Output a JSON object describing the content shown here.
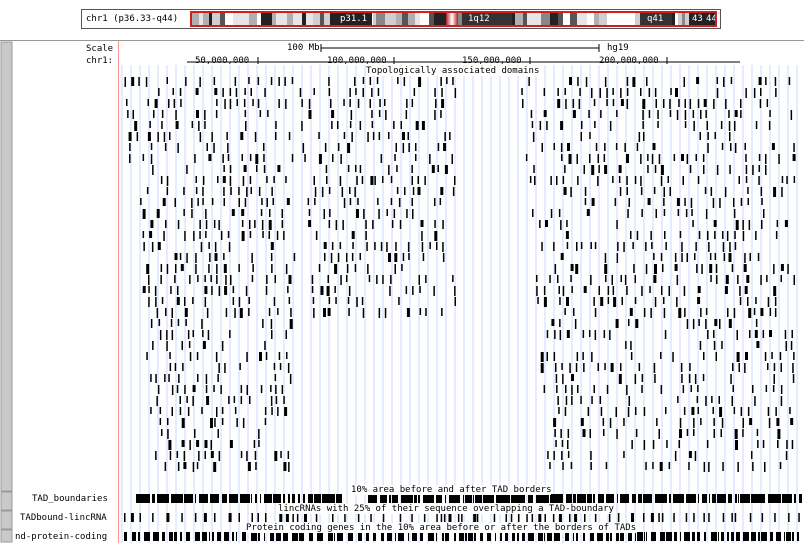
{
  "ideogram": {
    "position_label": "chr1 (p36.33-q44)",
    "band_labels": [
      "p31.1",
      "1q12",
      "q41",
      "43",
      "44"
    ]
  },
  "scale": {
    "label": "Scale",
    "bar_label": "100 Mb",
    "assembly": "hg19"
  },
  "ruler": {
    "chrom_label": "chr1:",
    "ticks": [
      "50,000,000",
      "100,000,000",
      "150,000,000",
      "200,000,000"
    ]
  },
  "tracks": {
    "tad_title": "Topologically associated domains",
    "area_title": "10% area before and after TAD borders",
    "tad_boundaries_label": "TAD_boundaries",
    "lincrna_title": "lincRNAs with 25% of their sequence overlapping a TAD-boundary",
    "tadbound_lincrna_label": "TADbound-lincRNA",
    "protein_title": "Protein coding genes in the 10% area before or after the borders of TADs",
    "protein_coding_label": "nd-protein-coding"
  },
  "colors": {
    "gridline": "#c8d8ff",
    "feature": "#000000",
    "ideogram_outline": "#cc2020",
    "side_button": "#c9c9c9"
  }
}
